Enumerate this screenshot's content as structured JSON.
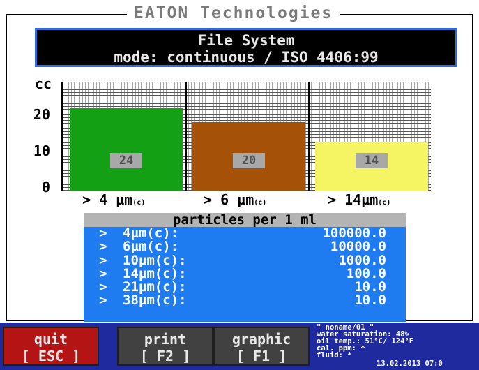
{
  "app": {
    "company": "EATON Technologies"
  },
  "header": {
    "line1": "File System",
    "line2": "mode: continuous / ISO 4406:99"
  },
  "chart_data": {
    "type": "bar",
    "ylabel": "cc",
    "yticks": [
      "20",
      "10",
      "0"
    ],
    "ylim": [
      0,
      30
    ],
    "categories": [
      "> 4 µm(c)",
      "> 6 µm(c)",
      "> 14µm(c)"
    ],
    "category_text": [
      "> 4  µm",
      "> 6  µm",
      "> 14µm"
    ],
    "category_suffix": "(c)",
    "values": [
      24,
      20,
      14
    ],
    "value_labels": [
      "24",
      "20",
      "14"
    ],
    "colors": [
      "#14a014",
      "#a55208",
      "#f5f564"
    ],
    "grid": true
  },
  "table": {
    "title": "particles per 1 ml",
    "rows": [
      {
        "marker": ">",
        "size": "4µm(c):",
        "value": "100000.0"
      },
      {
        "marker": ">",
        "size": "6µm(c):",
        "value": "10000.0"
      },
      {
        "marker": ">",
        "size": "10µm(c):",
        "value": "1000.0"
      },
      {
        "marker": ">",
        "size": "14µm(c):",
        "value": "100.0"
      },
      {
        "marker": ">",
        "size": "21µm(c):",
        "value": "10.0"
      },
      {
        "marker": ">",
        "size": "38µm(c):",
        "value": "10.0"
      }
    ]
  },
  "buttons": {
    "quit": {
      "label": "quit",
      "key": "[ ESC ]",
      "color": "#b41414"
    },
    "print": {
      "label": "print",
      "key": "[ F2 ]",
      "color": "#414141"
    },
    "graphic": {
      "label": "graphic",
      "key": "[ F1 ]",
      "color": "#414141"
    }
  },
  "info": {
    "name": "\" noname/01 \"",
    "water": "water saturation: 48%",
    "oil": "oil temp.: 51°C/ 124°F",
    "cal": "cal. ppm: *",
    "fluid": "fluid: *",
    "timestamp": "13.02.2013 07:0"
  }
}
